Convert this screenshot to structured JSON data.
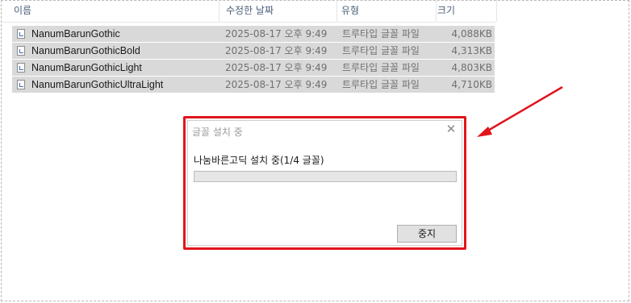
{
  "columns": {
    "name": "이름",
    "modified": "수정한 날짜",
    "type": "유형",
    "size": "크기",
    "sort_indicator": "^"
  },
  "files": [
    {
      "name": "NanumBarunGothic",
      "modified": "2025-08-17 오후 9:49",
      "type": "트루타입 글꼴 파일",
      "size": "4,088KB"
    },
    {
      "name": "NanumBarunGothicBold",
      "modified": "2025-08-17 오후 9:49",
      "type": "트루타입 글꼴 파일",
      "size": "4,313KB"
    },
    {
      "name": "NanumBarunGothicLight",
      "modified": "2025-08-17 오후 9:49",
      "type": "트루타입 글꼴 파일",
      "size": "4,803KB"
    },
    {
      "name": "NanumBarunGothicUltraLight",
      "modified": "2025-08-17 오후 9:49",
      "type": "트루타입 글꼴 파일",
      "size": "4,710KB"
    }
  ],
  "dialog": {
    "title": "글꼴 설치 중",
    "close_glyph": "✕",
    "message": "나눔바른고딕 설치 중(1/4 글꼴)",
    "progress_fraction": 0,
    "stop_label": "중지"
  },
  "colors": {
    "highlight_border": "#e1141c",
    "arrow": "#e1141c",
    "row_selected": "#d9d9d9"
  },
  "icons": {
    "file": "font-file-icon",
    "close": "close-icon",
    "annotation": "red-arrow-icon"
  }
}
